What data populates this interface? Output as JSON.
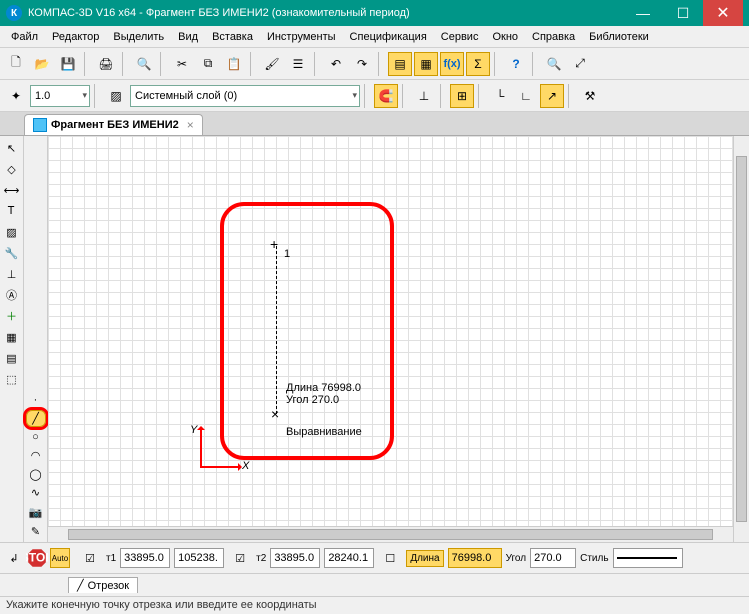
{
  "title": "КОМПАС-3D V16  x64 - Фрагмент БЕЗ ИМЕНИ2 (ознакомительный период)",
  "menubar": [
    "Файл",
    "Редактор",
    "Выделить",
    "Вид",
    "Вставка",
    "Инструменты",
    "Спецификация",
    "Сервис",
    "Окно",
    "Справка",
    "Библиотеки"
  ],
  "toolbar2": {
    "thickness": "1.0",
    "layer": "Системный слой (0)"
  },
  "doc_tab": {
    "label": "Фрагмент БЕЗ ИМЕНИ2"
  },
  "canvas": {
    "point_label": "1",
    "len_label": "Длина 76998.0",
    "ang_label": "Угол 270.0",
    "align_label": "Выравнивание",
    "x_axis": "X",
    "y_axis": "Y"
  },
  "params": {
    "t1_label": "т1",
    "t1_x": "33895.0",
    "t1_y": "105238.",
    "t2_label": "т2",
    "t2_x": "33895.0",
    "t2_y": "28240.1",
    "len_label": "Длина",
    "len": "76998.0",
    "ang_label": "Угол",
    "ang": "270.0",
    "style_label": "Стиль",
    "tab_label": "Отрезок"
  },
  "statusbar": "Укажите конечную точку отрезка или введите ее координаты"
}
